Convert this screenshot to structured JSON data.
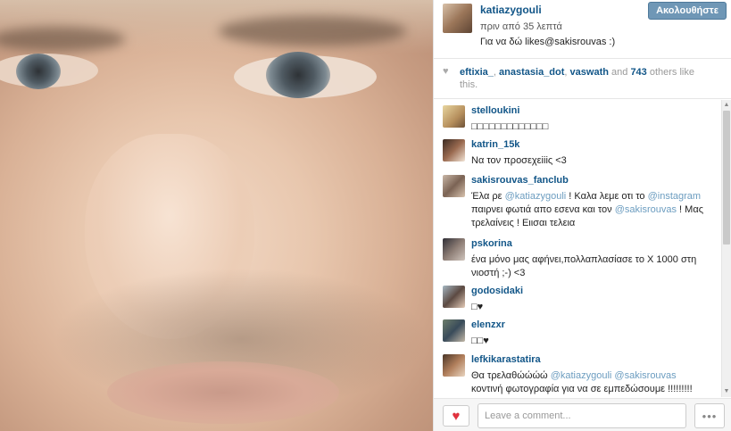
{
  "post": {
    "username": "katiazygouli",
    "time_ago": "πριν από 35 λεπτά",
    "caption": "Για να δώ likes@sakisrouvas :)",
    "follow_label": "Ακολουθήστε"
  },
  "likes": {
    "user1": "eftixia_",
    "sep1": ", ",
    "user2": "anastasia_dot",
    "sep2": ", ",
    "user3": "vaswath",
    "and_text": " and ",
    "count": "743",
    "others_text": " others like this."
  },
  "comments": [
    {
      "username": "stelloukini",
      "text": "□□□□□□□□□□□□□"
    },
    {
      "username": "katrin_15k",
      "text": "Να τον προσεχεiiiς <3"
    },
    {
      "username": "sakisrouvas_fanclub",
      "parts": [
        "Έλα ρε ",
        "@katiazygouli",
        " ! Καλα λεμε οτι το ",
        "@instagram",
        " παιρνει φωτιά απο εσενα και τον ",
        "@sakisrouvas",
        " ! Μας τρελαίνεις ! Ειισαι τελεια"
      ]
    },
    {
      "username": "pskorina",
      "text": "ένα μόνο μας αφήνει,πολλαπλασίασε το Χ 1000 στη νιοστή ;-) <3"
    },
    {
      "username": "godosidaki",
      "text": "□♥"
    },
    {
      "username": "elenzxr",
      "text": "□□♥"
    },
    {
      "username": "lefkikarastatira",
      "parts": [
        "Θα τρελαθώώώώ ",
        "@katiazygouli",
        " ",
        "@sakisrouvas",
        " κοντινή φωτογραφία για να σε εμπεδώσουμε !!!!!!!!! ♥♥♥♥"
      ]
    }
  ],
  "footer": {
    "comment_placeholder": "Leave a comment...",
    "more_label": "•••",
    "like_icon": "heart-icon"
  },
  "colors": {
    "link": "#125688",
    "mention": "#6c9dc0",
    "follow_button": "#6f97b6",
    "like_heart": "#e0323e"
  }
}
